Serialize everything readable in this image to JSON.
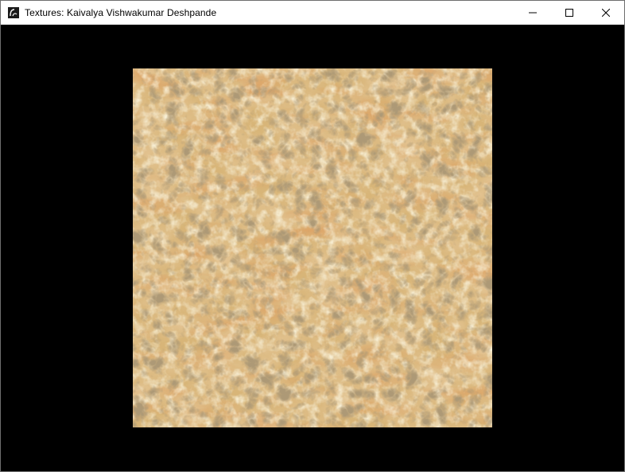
{
  "window": {
    "title": "Textures: Kaivalya Vishwakumar Deshpande",
    "app_icon": "opengl-app-icon",
    "controls": {
      "minimize_icon": "minimize-icon",
      "maximize_icon": "maximize-icon",
      "close_icon": "close-icon"
    }
  },
  "viewport": {
    "background_color": "#000000",
    "texture": {
      "description_name": "marble-stone-texture",
      "colors": [
        "#c99856",
        "#b86a2a",
        "#e3c88c",
        "#8a6a3a",
        "#f2e3b8"
      ]
    }
  }
}
